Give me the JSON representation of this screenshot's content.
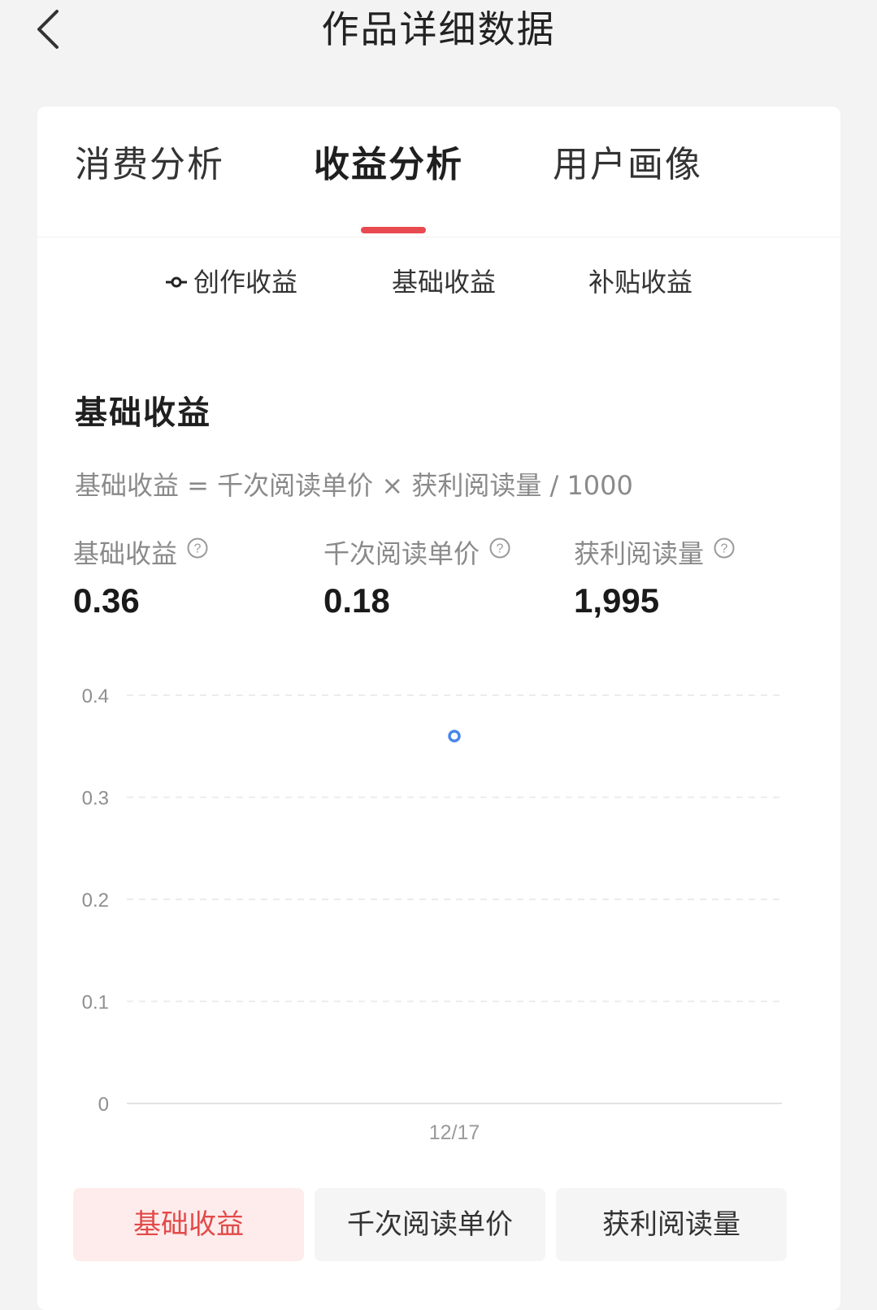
{
  "header": {
    "title": "作品详细数据"
  },
  "tabs": [
    {
      "label": "消费分析",
      "active": false
    },
    {
      "label": "收益分析",
      "active": true
    },
    {
      "label": "用户画像",
      "active": false
    }
  ],
  "legend": {
    "items": [
      {
        "label": "创作收益",
        "marker": "line-dot-icon"
      },
      {
        "label": "基础收益"
      },
      {
        "label": "补贴收益"
      }
    ]
  },
  "section": {
    "title": "基础收益",
    "formula": "基础收益 = 千次阅读单价 × 获利阅读量 / 1000"
  },
  "metrics": [
    {
      "label": "基础收益",
      "value": "0.36"
    },
    {
      "label": "千次阅读单价",
      "value": "0.18"
    },
    {
      "label": "获利阅读量",
      "value": "1,995"
    }
  ],
  "chart_data": {
    "type": "scatter",
    "x": [
      "12/17"
    ],
    "series": [
      {
        "values": [
          0.36
        ],
        "color": "#4a86e8"
      }
    ],
    "yticks": [
      "0.4",
      "0.3",
      "0.2",
      "0.1",
      "0"
    ],
    "ylim": [
      0,
      0.4
    ],
    "grid": true
  },
  "buttons": [
    {
      "label": "基础收益",
      "active": true
    },
    {
      "label": "千次阅读单价",
      "active": false
    },
    {
      "label": "获利阅读量",
      "active": false
    }
  ],
  "colors": {
    "accent": "#e84a4f",
    "point": "#4a86e8",
    "active_button_bg": "#fdeceb"
  }
}
